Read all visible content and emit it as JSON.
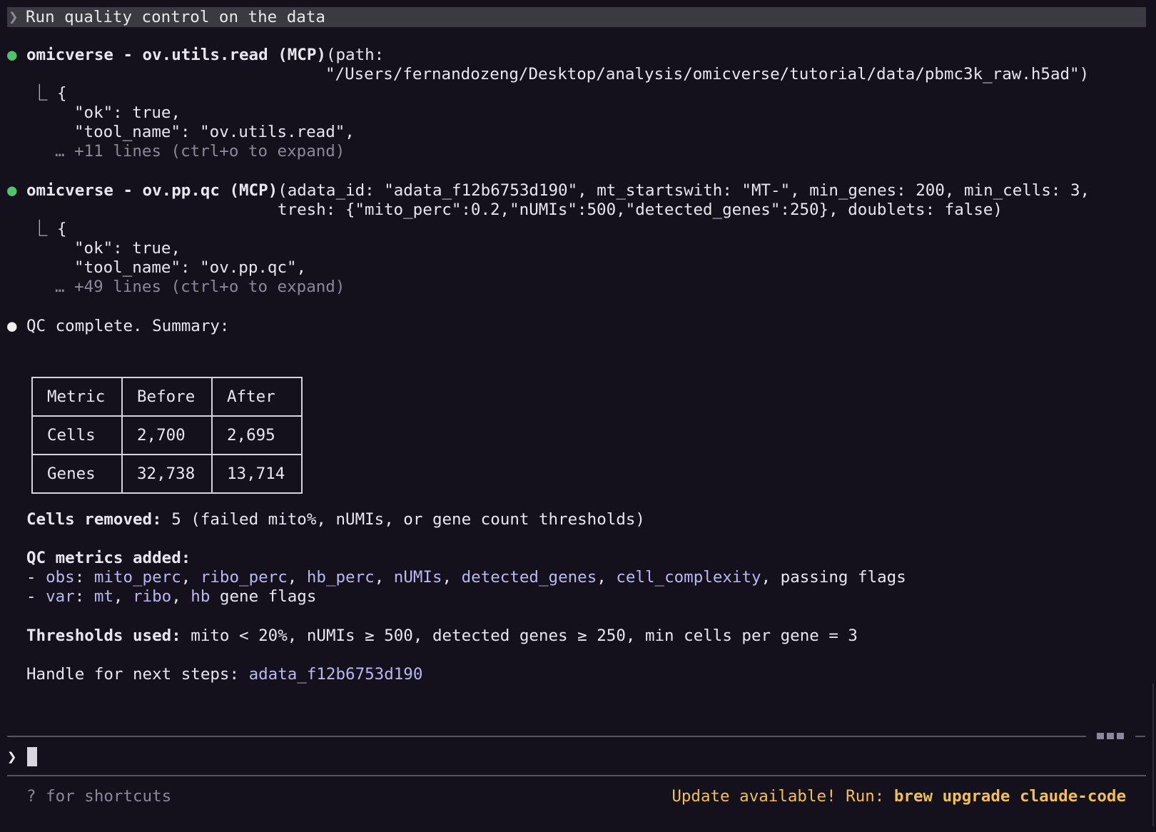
{
  "user_prompt": {
    "chevron": "❯",
    "text": "Run quality control on the data"
  },
  "tool_calls": [
    {
      "status_dot": "●",
      "name": "omicverse - ov.utils.read (MCP)",
      "args_line1": "(path:",
      "args_line2": "\"/Users/fernandozeng/Desktop/analysis/omicverse/tutorial/data/pbmc3k_raw.h5ad\")",
      "result_prefix": "⎿ {",
      "result_lines": [
        "\"ok\": true,",
        "\"tool_name\": \"ov.utils.read\","
      ],
      "collapsed": "… +11 lines (ctrl+o to expand)"
    },
    {
      "status_dot": "●",
      "name": "omicverse - ov.pp.qc (MCP)",
      "args_line1": "(adata_id: \"adata_f12b6753d190\", mt_startswith: \"MT-\", min_genes: 200, min_cells: 3,",
      "args_line2": "tresh: {\"mito_perc\":0.2,\"nUMIs\":500,\"detected_genes\":250}, doublets: false)",
      "result_prefix": "⎿ {",
      "result_lines": [
        "\"ok\": true,",
        "\"tool_name\": \"ov.pp.qc\","
      ],
      "collapsed": "… +49 lines (ctrl+o to expand)"
    }
  ],
  "response": {
    "dot": "●",
    "heading": "QC complete. Summary:",
    "table": {
      "headers": [
        "Metric",
        "Before",
        "After"
      ],
      "rows": [
        [
          "Cells",
          "2,700",
          "2,695"
        ],
        [
          "Genes",
          "32,738",
          "13,714"
        ]
      ]
    },
    "cells_removed_label": "Cells removed:",
    "cells_removed_text": " 5 (failed mito%, nUMIs, or gene count thresholds)",
    "metrics_label": "QC metrics added:",
    "obs_line": {
      "prefix": "- ",
      "key": "obs",
      "sep": ": ",
      "items": [
        "mito_perc",
        "ribo_perc",
        "hb_perc",
        "nUMIs",
        "detected_genes",
        "cell_complexity"
      ],
      "suffix": ", passing flags"
    },
    "var_line": {
      "prefix": "- ",
      "key": "var",
      "sep": ": ",
      "items": [
        "mt",
        "ribo",
        "hb"
      ],
      "suffix": " gene flags"
    },
    "thresholds_label": "Thresholds used:",
    "thresholds_text": " mito < 20%, nUMIs ≥ 500, detected genes ≥ 250, min cells per gene = 3",
    "handle_label": "Handle for next steps: ",
    "handle_value": "adata_f12b6753d190"
  },
  "input": {
    "chevron": "❯"
  },
  "footer": {
    "shortcuts_hint": "? for shortcuts",
    "update_prefix": "Update available! Run: ",
    "update_command": "brew upgrade claude-code"
  },
  "colors": {
    "background": "#14101c",
    "success_dot": "#4fc46d",
    "highlight": "#b8b9f2",
    "update": "#f2c04d"
  }
}
